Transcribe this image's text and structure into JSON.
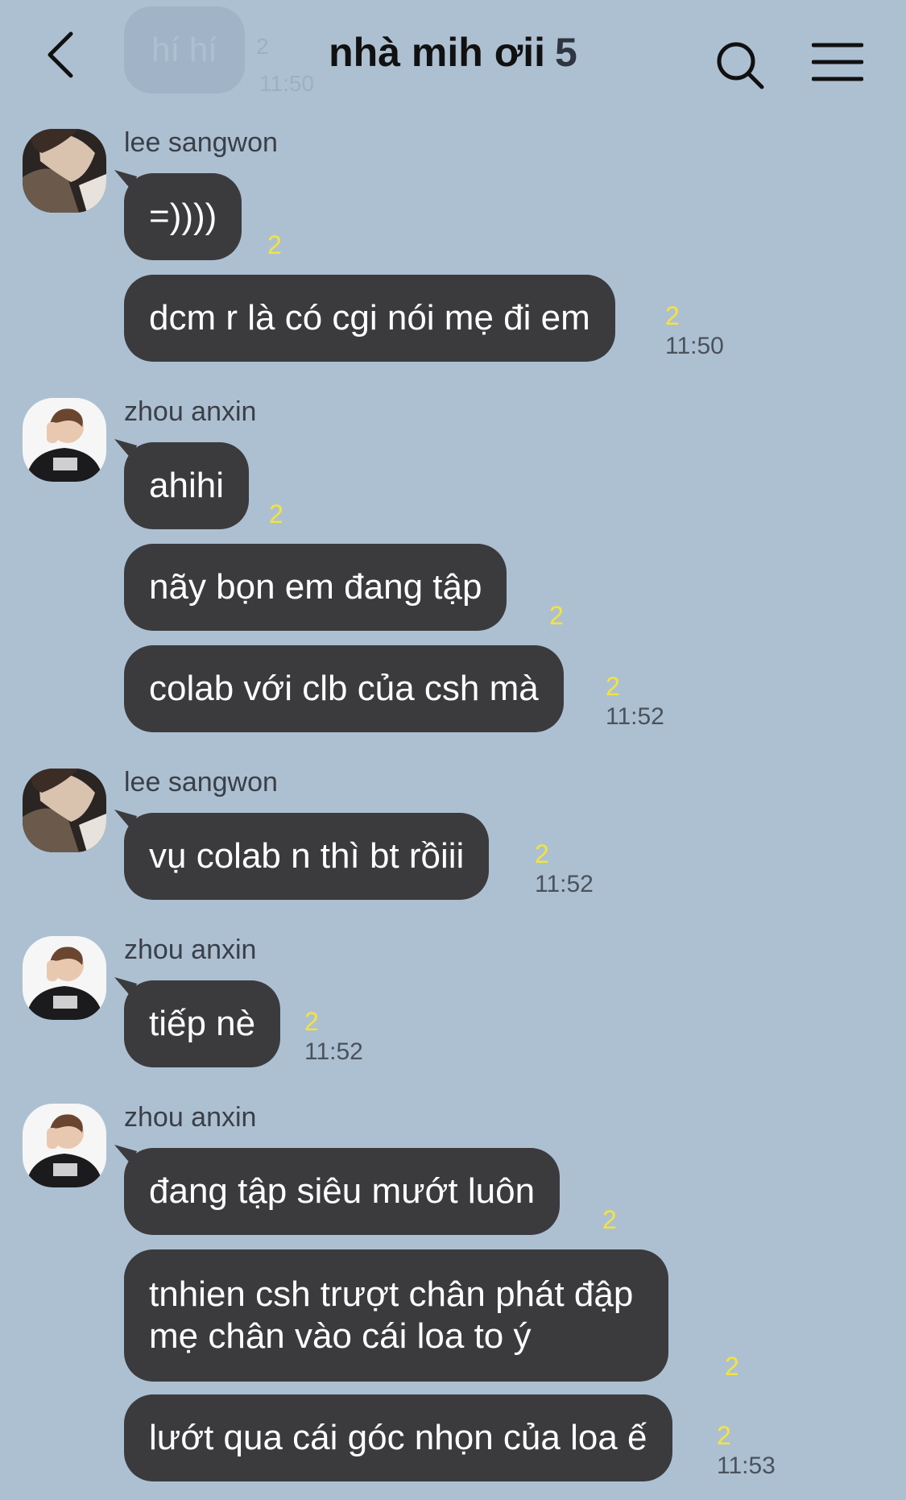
{
  "header": {
    "title": "nhà mih ơii",
    "member_count": "5",
    "ghost_bubble_text": "hí hí",
    "ghost_unread": "2",
    "ghost_time": "11:50"
  },
  "icons": [
    "back-arrow-icon",
    "search-icon",
    "menu-icon"
  ],
  "colors": {
    "background": "#adc0d2",
    "bubble": "#3b3b3e",
    "unread": "#f5e33b",
    "time": "#4a525c"
  },
  "messages": [
    {
      "sender": "lee sangwon",
      "items": [
        {
          "text": "=))))",
          "unread": "2",
          "time": ""
        },
        {
          "text": "dcm r là có cgi nói mẹ đi em",
          "unread": "2",
          "time": "11:50"
        }
      ]
    },
    {
      "sender": "zhou anxin",
      "items": [
        {
          "text": "ahihi",
          "unread": "2",
          "time": ""
        },
        {
          "text": "nãy bọn em đang tập",
          "unread": "2",
          "time": ""
        },
        {
          "text": "colab với clb của csh mà",
          "unread": "2",
          "time": "11:52"
        }
      ]
    },
    {
      "sender": "lee sangwon",
      "items": [
        {
          "text": "vụ colab n thì bt rồiii",
          "unread": "2",
          "time": "11:52"
        }
      ]
    },
    {
      "sender": "zhou anxin",
      "items": [
        {
          "text": "tiếp nè",
          "unread": "2",
          "time": "11:52"
        }
      ]
    },
    {
      "sender": "zhou anxin",
      "items": [
        {
          "text": "đang tập siêu mướt luôn",
          "unread": "2",
          "time": ""
        },
        {
          "text_line1": "tnhien csh trượt chân phát đập",
          "text_line2": "mẹ chân vào cái loa to ý",
          "unread": "2",
          "time": ""
        },
        {
          "text": "lướt qua cái góc nhọn của loa ế",
          "unread": "2",
          "time": "11:53"
        }
      ]
    }
  ]
}
